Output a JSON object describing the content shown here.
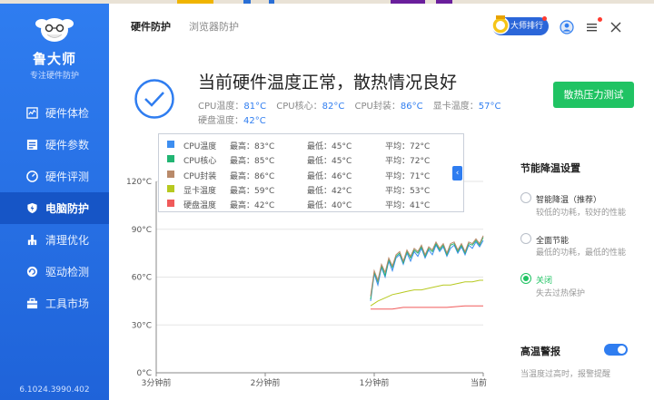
{
  "app": {
    "name": "鲁大师",
    "subtitle": "专注硬件防护",
    "version": "6.1024.3990.402"
  },
  "sidebar": {
    "items": [
      {
        "label": "硬件体检",
        "icon": "pulse-chart-icon",
        "active": false
      },
      {
        "label": "硬件参数",
        "icon": "list-icon",
        "active": false
      },
      {
        "label": "硬件评测",
        "icon": "gauge-icon",
        "active": false
      },
      {
        "label": "电脑防护",
        "icon": "shield-bolt-icon",
        "active": true
      },
      {
        "label": "清理优化",
        "icon": "broom-icon",
        "active": false
      },
      {
        "label": "驱动检测",
        "icon": "refresh-icon",
        "active": false
      },
      {
        "label": "工具市场",
        "icon": "toolbox-icon",
        "active": false
      }
    ]
  },
  "tabs": [
    {
      "label": "硬件防护",
      "active": true
    },
    {
      "label": "浏览器防护",
      "active": false
    }
  ],
  "header": {
    "rank_label": "大师排行"
  },
  "status": {
    "title": "当前硬件温度正常，散热情况良好",
    "readings": [
      {
        "label": "CPU温度：",
        "value": "81°C"
      },
      {
        "label": "CPU核心：",
        "value": "82°C"
      },
      {
        "label": "CPU封装：",
        "value": "86°C"
      },
      {
        "label": "显卡温度：",
        "value": "57°C"
      },
      {
        "label": "硬盘温度：",
        "value": "42°C"
      }
    ],
    "stress_button": "散热压力测试"
  },
  "legend": {
    "toggle": "‹",
    "rows": [
      {
        "name": "CPU温度",
        "max": "最高：83°C",
        "min": "最低：45°C",
        "avg": "平均：72°C",
        "color": "#3d8ef0"
      },
      {
        "name": "CPU核心",
        "max": "最高：85°C",
        "min": "最低：45°C",
        "avg": "平均：72°C",
        "color": "#22b573"
      },
      {
        "name": "CPU封装",
        "max": "最高：86°C",
        "min": "最低：46°C",
        "avg": "平均：71°C",
        "color": "#b98a6a"
      },
      {
        "name": "显卡温度",
        "max": "最高：59°C",
        "min": "最低：42°C",
        "avg": "平均：53°C",
        "color": "#b7c920"
      },
      {
        "name": "硬盘温度",
        "max": "最高：42°C",
        "min": "最低：40°C",
        "avg": "平均：41°C",
        "color": "#f05a5a"
      }
    ]
  },
  "chart_data": {
    "type": "line",
    "y_ticks": [
      "120°C",
      "90°C",
      "60°C",
      "30°C",
      "0°C"
    ],
    "x_ticks": [
      "3分钟前",
      "2分钟前",
      "1分钟前",
      "当前"
    ],
    "ylim": [
      0,
      120
    ],
    "xlim": [
      -180,
      0
    ],
    "grid": true,
    "series": [
      {
        "name": "CPU温度",
        "color": "#3d8ef0",
        "x": [
          -62,
          -60,
          -58,
          -56,
          -54,
          -52,
          -50,
          -48,
          -46,
          -44,
          -42,
          -40,
          -38,
          -36,
          -34,
          -32,
          -30,
          -28,
          -26,
          -24,
          -22,
          -20,
          -18,
          -16,
          -14,
          -12,
          -10,
          -8,
          -6,
          -4,
          -2,
          0
        ],
        "values": [
          45,
          62,
          55,
          66,
          60,
          70,
          64,
          72,
          74,
          68,
          75,
          70,
          76,
          73,
          78,
          72,
          77,
          74,
          80,
          76,
          79,
          73,
          78,
          80,
          75,
          79,
          74,
          80,
          78,
          82,
          79,
          83
        ]
      },
      {
        "name": "CPU核心",
        "color": "#22b573",
        "x": [
          -62,
          -60,
          -58,
          -56,
          -54,
          -52,
          -50,
          -48,
          -46,
          -44,
          -42,
          -40,
          -38,
          -36,
          -34,
          -32,
          -30,
          -28,
          -26,
          -24,
          -22,
          -20,
          -18,
          -16,
          -14,
          -12,
          -10,
          -8,
          -6,
          -4,
          -2,
          0
        ],
        "values": [
          46,
          63,
          57,
          67,
          61,
          71,
          66,
          73,
          75,
          69,
          76,
          72,
          77,
          75,
          79,
          73,
          78,
          76,
          81,
          77,
          80,
          74,
          80,
          81,
          76,
          80,
          75,
          81,
          80,
          83,
          80,
          85
        ]
      },
      {
        "name": "CPU封装",
        "color": "#b98a6a",
        "x": [
          -62,
          -60,
          -58,
          -56,
          -54,
          -52,
          -50,
          -48,
          -46,
          -44,
          -42,
          -40,
          -38,
          -36,
          -34,
          -32,
          -30,
          -28,
          -26,
          -24,
          -22,
          -20,
          -18,
          -16,
          -14,
          -12,
          -10,
          -8,
          -6,
          -4,
          -2,
          0
        ],
        "values": [
          48,
          64,
          58,
          68,
          63,
          72,
          67,
          74,
          76,
          70,
          77,
          73,
          78,
          76,
          80,
          74,
          79,
          77,
          82,
          78,
          81,
          75,
          81,
          82,
          77,
          81,
          76,
          82,
          81,
          84,
          81,
          86
        ]
      },
      {
        "name": "显卡温度",
        "color": "#b7c920",
        "x": [
          -62,
          -58,
          -54,
          -50,
          -46,
          -42,
          -38,
          -34,
          -30,
          -26,
          -22,
          -18,
          -14,
          -10,
          -6,
          -2,
          0
        ],
        "values": [
          42,
          45,
          47,
          49,
          50,
          51,
          52,
          52,
          53,
          54,
          55,
          55,
          56,
          57,
          57,
          58,
          58
        ]
      },
      {
        "name": "硬盘温度",
        "color": "#f05a5a",
        "x": [
          -62,
          -56,
          -50,
          -44,
          -40,
          -30,
          -20,
          -10,
          0
        ],
        "values": [
          40,
          40,
          40,
          41,
          41,
          41,
          41,
          42,
          42
        ]
      }
    ]
  },
  "cooling": {
    "title": "节能降温设置",
    "options": [
      {
        "label": "智能降温（推荐）",
        "desc": "较低的功耗，较好的性能",
        "selected": false
      },
      {
        "label": "全面节能",
        "desc": "最低的功耗，最低的性能",
        "selected": false
      },
      {
        "label": "关闭",
        "desc": "失去过热保护",
        "selected": true
      }
    ]
  },
  "alarm": {
    "title": "高温警报",
    "desc": "当温度过高时，报警提醒",
    "enabled": true
  }
}
